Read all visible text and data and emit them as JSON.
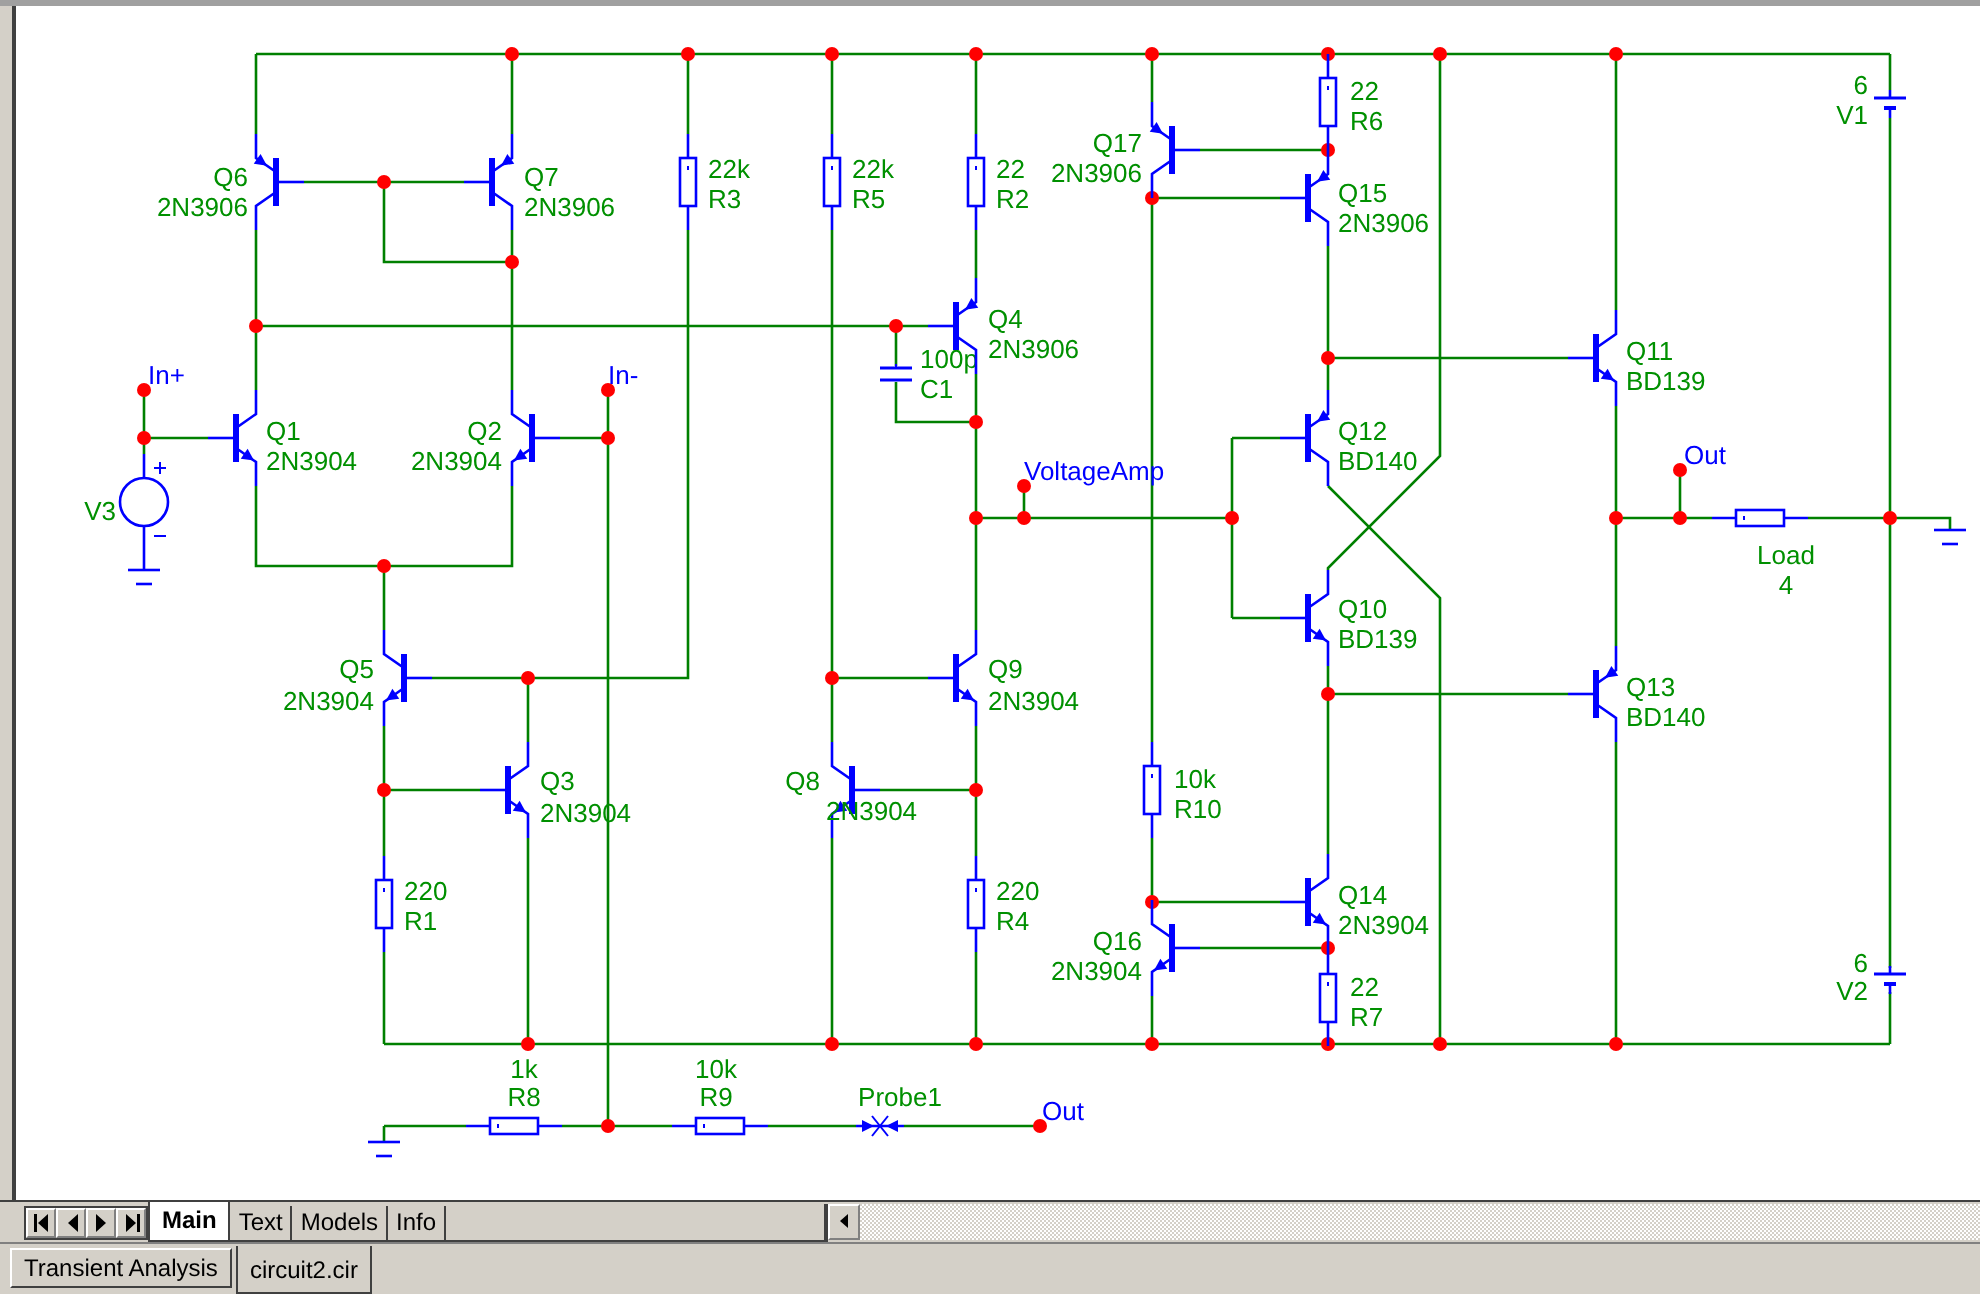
{
  "schematic": {
    "components": [
      {
        "kind": "pnp",
        "name": "Q6",
        "value": "2N3906"
      },
      {
        "kind": "pnp",
        "name": "Q7",
        "value": "2N3906"
      },
      {
        "kind": "npn",
        "name": "Q1",
        "value": "2N3904"
      },
      {
        "kind": "npn",
        "name": "Q2",
        "value": "2N3904"
      },
      {
        "kind": "resistor",
        "name": "R3",
        "value": "22k"
      },
      {
        "kind": "resistor",
        "name": "R5",
        "value": "22k"
      },
      {
        "kind": "resistor",
        "name": "R2",
        "value": "22"
      },
      {
        "kind": "capacitor",
        "name": "C1",
        "value": "100p"
      },
      {
        "kind": "pnp",
        "name": "Q4",
        "value": "2N3906"
      },
      {
        "kind": "pnp",
        "name": "Q17",
        "value": "2N3906"
      },
      {
        "kind": "resistor",
        "name": "R6",
        "value": "22"
      },
      {
        "kind": "pnp",
        "name": "Q15",
        "value": "2N3906"
      },
      {
        "kind": "pnp",
        "name": "Q12",
        "value": "BD140"
      },
      {
        "kind": "npn",
        "name": "Q11",
        "value": "BD139"
      },
      {
        "kind": "battery",
        "name": "V1",
        "value": "6"
      },
      {
        "kind": "source",
        "name": "V3"
      },
      {
        "kind": "resistor",
        "name": "Load",
        "value": "4"
      },
      {
        "kind": "npn",
        "name": "Q10",
        "value": "BD139"
      },
      {
        "kind": "npn",
        "name": "Q5",
        "value": "2N3904"
      },
      {
        "kind": "npn",
        "name": "Q9",
        "value": "2N3904"
      },
      {
        "kind": "pnp",
        "name": "Q13",
        "value": "BD140"
      },
      {
        "kind": "npn",
        "name": "Q3",
        "value": "2N3904"
      },
      {
        "kind": "npn",
        "name": "Q8",
        "value": "2N3904"
      },
      {
        "kind": "resistor",
        "name": "R10",
        "value": "10k"
      },
      {
        "kind": "resistor",
        "name": "R1",
        "value": "220"
      },
      {
        "kind": "resistor",
        "name": "R4",
        "value": "220"
      },
      {
        "kind": "npn",
        "name": "Q14",
        "value": "2N3904"
      },
      {
        "kind": "npn",
        "name": "Q16",
        "value": "2N3904"
      },
      {
        "kind": "resistor",
        "name": "R7",
        "value": "22"
      },
      {
        "kind": "battery",
        "name": "V2",
        "value": "6"
      },
      {
        "kind": "resistor",
        "name": "R8",
        "value": "1k"
      },
      {
        "kind": "resistor",
        "name": "R9",
        "value": "10k"
      },
      {
        "kind": "probe",
        "name": "Probe1"
      }
    ],
    "net_labels": [
      {
        "text": "In+"
      },
      {
        "text": "In-"
      },
      {
        "text": "VoltageAmp"
      },
      {
        "text": "Out"
      },
      {
        "text": "Out"
      }
    ]
  },
  "sheet_tabs": [
    {
      "label": "Main",
      "selected": true
    },
    {
      "label": "Text",
      "selected": false
    },
    {
      "label": "Models",
      "selected": false
    },
    {
      "label": "Info",
      "selected": false
    }
  ],
  "document_tabs": [
    {
      "label": "Transient Analysis",
      "selected": false
    },
    {
      "label": "circuit2.cir",
      "selected": true
    }
  ]
}
